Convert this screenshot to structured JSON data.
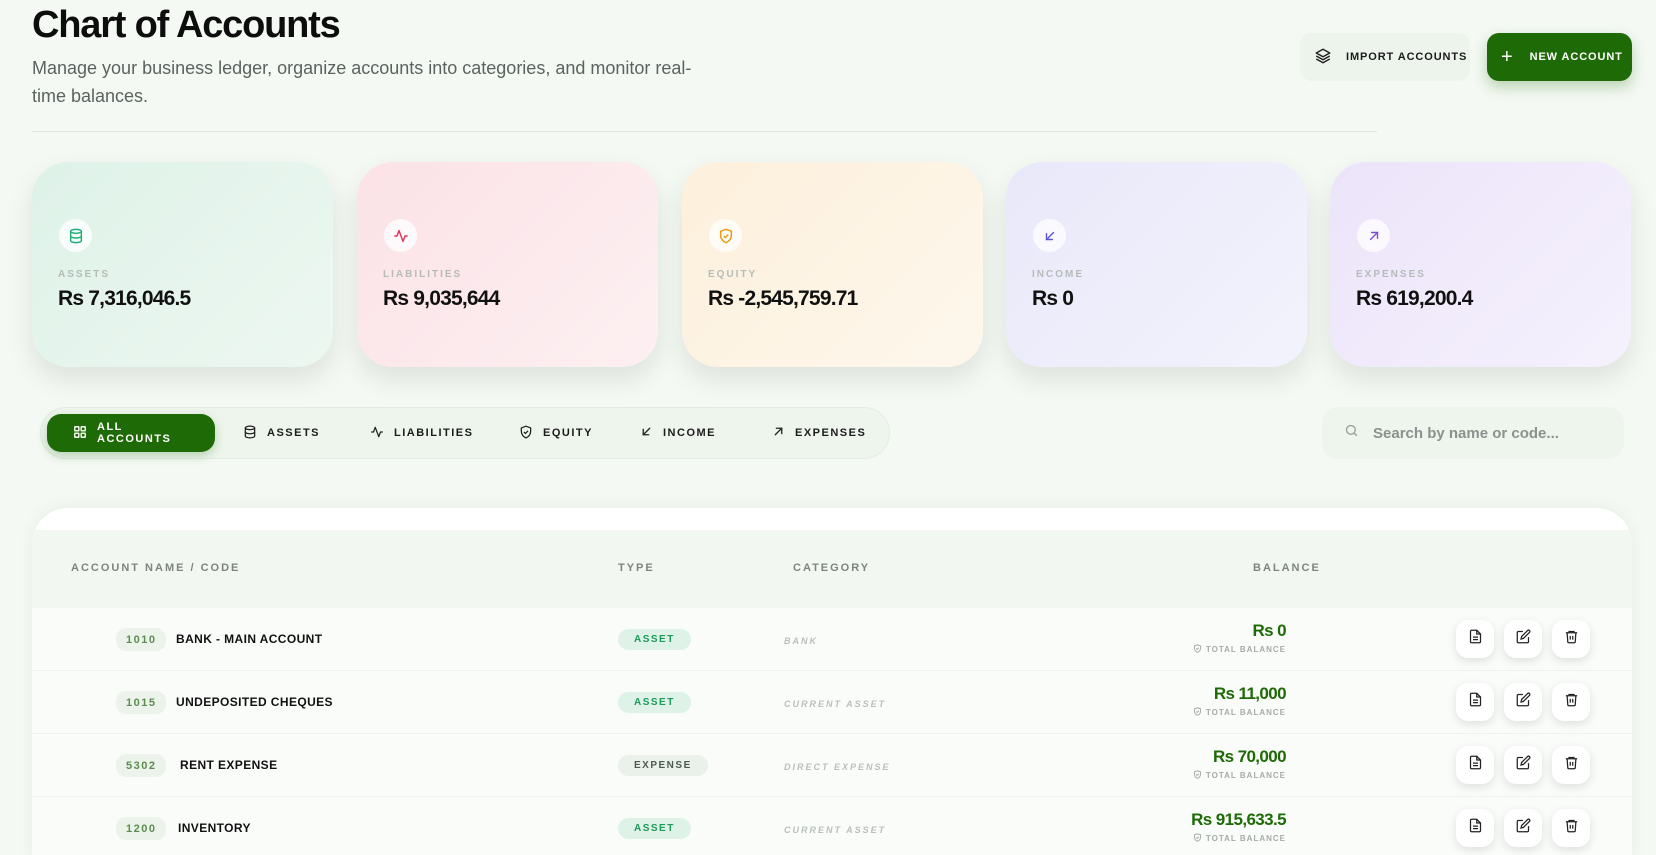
{
  "header": {
    "title": "Chart of Accounts",
    "subtitle": "Manage your business ledger, organize accounts into categories, and monitor real-time balances.",
    "import_label": "IMPORT ACCOUNTS",
    "new_label": "NEW ACCOUNT"
  },
  "stats": [
    {
      "label": "ASSETS",
      "value": "Rs 7,316,046.5",
      "icon": "database-icon",
      "color": "#22b07a"
    },
    {
      "label": "LIABILITIES",
      "value": "Rs 9,035,644",
      "icon": "activity-icon",
      "color": "#e0355a"
    },
    {
      "label": "EQUITY",
      "value": "Rs -2,545,759.71",
      "icon": "shield-check-icon",
      "color": "#e89a10"
    },
    {
      "label": "INCOME",
      "value": "Rs 0",
      "icon": "arrow-down-left-icon",
      "color": "#5a55d8"
    },
    {
      "label": "EXPENSES",
      "value": "Rs 619,200.4",
      "icon": "arrow-up-right-icon",
      "color": "#7a4fd6"
    }
  ],
  "filters": [
    {
      "label": "ALL ACCOUNTS",
      "icon": "grid-icon",
      "active": true
    },
    {
      "label": "ASSETS",
      "icon": "database-icon"
    },
    {
      "label": "LIABILITIES",
      "icon": "activity-icon"
    },
    {
      "label": "EQUITY",
      "icon": "shield-check-icon"
    },
    {
      "label": "INCOME",
      "icon": "arrow-down-left-icon"
    },
    {
      "label": "EXPENSES",
      "icon": "arrow-up-right-icon"
    }
  ],
  "search": {
    "placeholder": "Search by name or code..."
  },
  "table": {
    "headers": {
      "name": "ACCOUNT NAME / CODE",
      "type": "TYPE",
      "category": "CATEGORY",
      "balance": "BALANCE"
    },
    "rows": [
      {
        "code": "1010",
        "name": "BANK - MAIN ACCOUNT",
        "type": "ASSET",
        "category": "BANK",
        "balance": "Rs 0",
        "balance_label": "TOTAL BALANCE"
      },
      {
        "code": "1015",
        "name": "UNDEPOSITED CHEQUES",
        "type": "ASSET",
        "category": "CURRENT ASSET",
        "balance": "Rs 11,000",
        "balance_label": "TOTAL BALANCE"
      },
      {
        "code": "5302",
        "name": "RENT EXPENSE",
        "type": "EXPENSE",
        "category": "DIRECT EXPENSE",
        "balance": "Rs 70,000",
        "balance_label": "TOTAL BALANCE"
      },
      {
        "code": "1200",
        "name": "INVENTORY",
        "type": "ASSET",
        "category": "CURRENT ASSET",
        "balance": "Rs 915,633.5",
        "balance_label": "TOTAL BALANCE"
      }
    ]
  },
  "colors": {
    "brand": "#1e6a06",
    "background": "#f4f9f3"
  }
}
